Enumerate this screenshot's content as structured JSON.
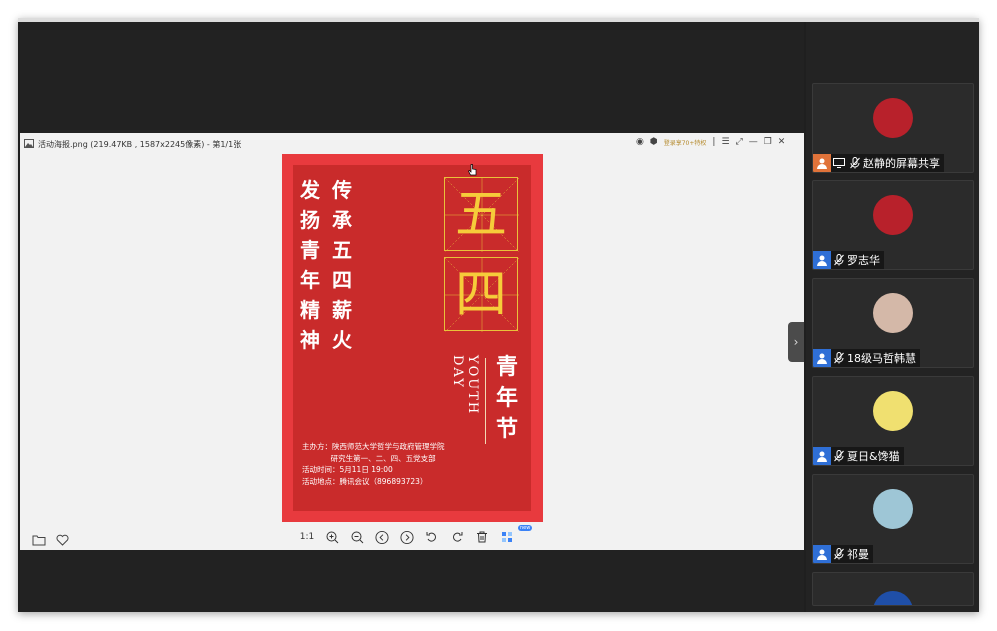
{
  "viewer": {
    "filename": "活动海报.png (219.47KB , 1587x2245像素) - 第1/1张",
    "vip_badge": "登录享70+特权",
    "toolbar": {
      "actual_size_label": "1:1",
      "new_badge": "new"
    }
  },
  "poster": {
    "col_left": [
      "发",
      "扬",
      "青",
      "年",
      "精",
      "神"
    ],
    "col_right": [
      "传",
      "承",
      "五",
      "四",
      "薪",
      "火"
    ],
    "big_top": "五",
    "big_bottom": "四",
    "youth_day": "YOUTH DAY",
    "title_vertical": [
      "青",
      "年",
      "节"
    ],
    "info_lines": [
      "主办方：陕西师范大学哲学与政府管理学院",
      "            研究生第一、二、四、五党支部",
      "活动时间：5月11日 19:00",
      "活动地点：腾讯会议（896893723）"
    ],
    "colors": {
      "border": "#e83a3e",
      "fill": "#c92b2b",
      "gold": "#f6cc3a"
    }
  },
  "participants": [
    {
      "name": "赵静的屏幕共享",
      "icon_color": "#e0733a",
      "avatar_color": "#b8212b",
      "icon": "person-icon",
      "sharing": true
    },
    {
      "name": "罗志华",
      "icon_color": "#2f6fd6",
      "avatar_color": "#b8212b",
      "icon": "person-icon"
    },
    {
      "name": "18级马哲韩慧",
      "icon_color": "#2f6fd6",
      "avatar_color": "#d4b8a8",
      "icon": "person-icon"
    },
    {
      "name": "夏日&馋猫",
      "icon_color": "#2f6fd6",
      "avatar_color": "#f0e070",
      "icon": "person-icon"
    },
    {
      "name": "祁曼",
      "icon_color": "#2f6fd6",
      "avatar_color": "#9ec6d6",
      "icon": "person-icon"
    }
  ]
}
